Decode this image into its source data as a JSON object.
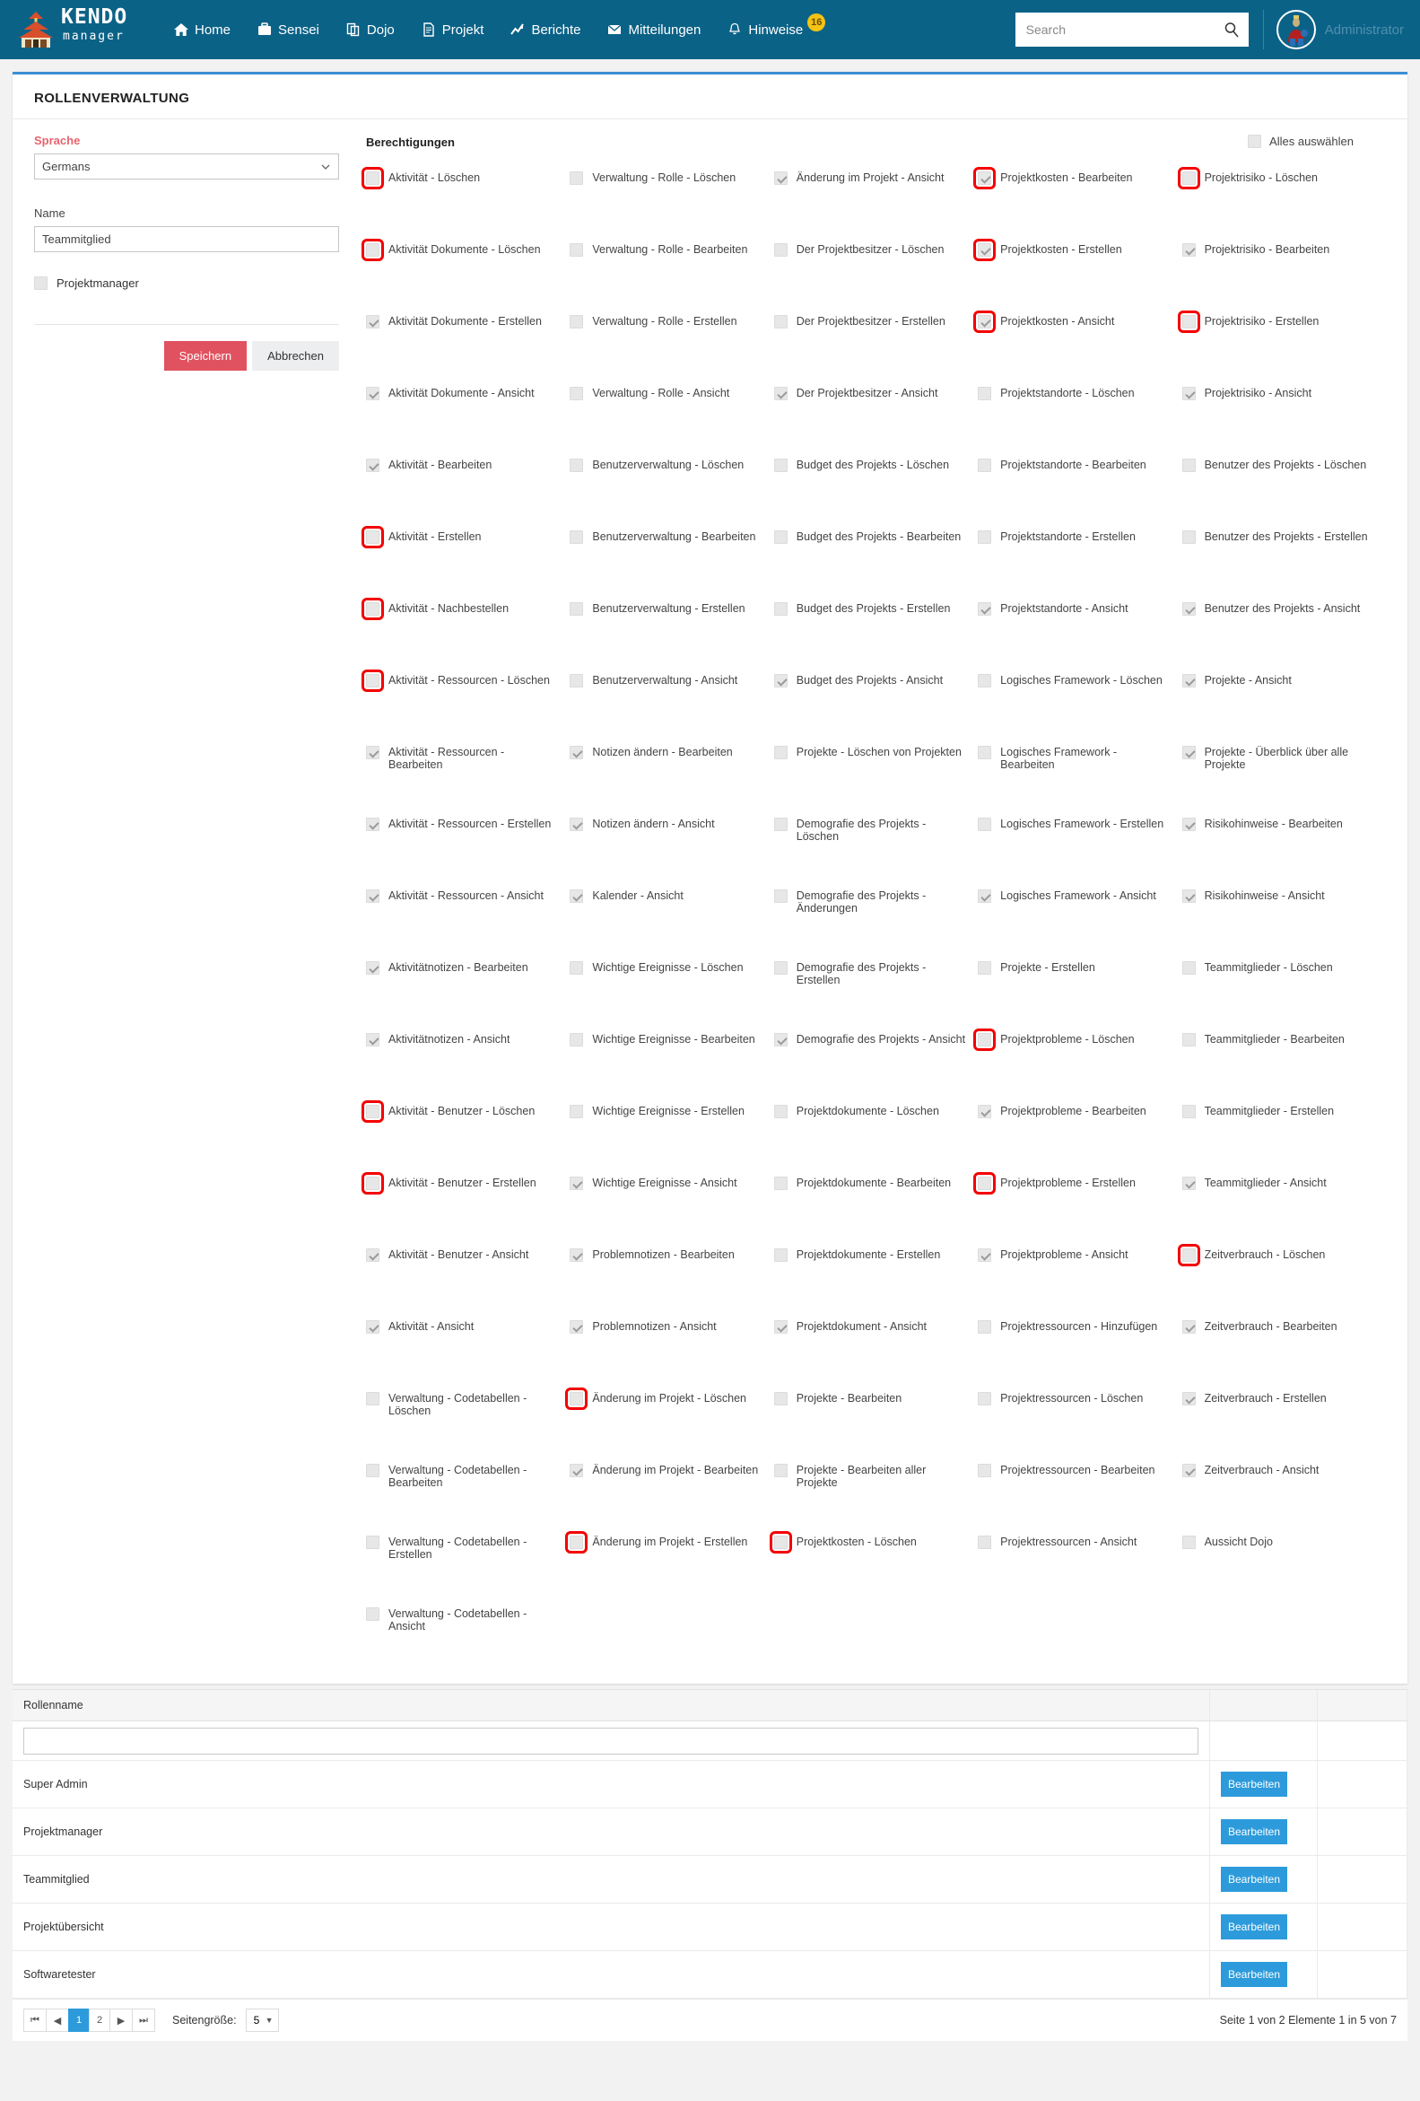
{
  "topbar": {
    "brand_main": "KENDO",
    "brand_sub": "manager",
    "nav": [
      {
        "label": "Home",
        "icon": "home-icon"
      },
      {
        "label": "Sensei",
        "icon": "briefcase-icon"
      },
      {
        "label": "Dojo",
        "icon": "copy-icon"
      },
      {
        "label": "Projekt",
        "icon": "file-icon"
      },
      {
        "label": "Berichte",
        "icon": "chart-icon"
      },
      {
        "label": "Mitteilungen",
        "icon": "envelope-icon"
      },
      {
        "label": "Hinweise",
        "icon": "bell-icon",
        "badge": "16"
      }
    ],
    "search_placeholder": "Search",
    "search_value": "",
    "user_name": "Administrator"
  },
  "card": {
    "title": "ROLLENVERWALTUNG",
    "form": {
      "language_label": "Sprache",
      "language_value": "Germans",
      "name_label": "Name",
      "name_value": "Teammitglied",
      "projectmanager_label": "Projektmanager",
      "projectmanager_checked": false,
      "save_label": "Speichern",
      "cancel_label": "Abbrechen"
    },
    "permissions": {
      "title": "Berechtigungen",
      "select_all_label": "Alles auswählen",
      "select_all_checked": false,
      "columns": [
        [
          {
            "label": "Aktivität - Löschen",
            "checked": false,
            "highlight": true
          },
          {
            "label": "Aktivität Dokumente - Löschen",
            "checked": false,
            "highlight": true
          },
          {
            "label": "Aktivität Dokumente - Erstellen",
            "checked": true,
            "highlight": false
          },
          {
            "label": "Aktivität Dokumente - Ansicht",
            "checked": true,
            "highlight": false
          },
          {
            "label": "Aktivität - Bearbeiten",
            "checked": true,
            "highlight": false
          },
          {
            "label": "Aktivität - Erstellen",
            "checked": false,
            "highlight": true
          },
          {
            "label": "Aktivität - Nachbestellen",
            "checked": false,
            "highlight": true
          },
          {
            "label": "Aktivität - Ressourcen - Löschen",
            "checked": false,
            "highlight": true
          },
          {
            "label": "Aktivität - Ressourcen - Bearbeiten",
            "checked": true,
            "highlight": false
          },
          {
            "label": "Aktivität - Ressourcen - Erstellen",
            "checked": true,
            "highlight": false
          },
          {
            "label": "Aktivität - Ressourcen - Ansicht",
            "checked": true,
            "highlight": false
          },
          {
            "label": "Aktivitätnotizen - Bearbeiten",
            "checked": true,
            "highlight": false
          },
          {
            "label": "Aktivitätnotizen - Ansicht",
            "checked": true,
            "highlight": false
          },
          {
            "label": "Aktivität - Benutzer - Löschen",
            "checked": false,
            "highlight": true
          },
          {
            "label": "Aktivität - Benutzer - Erstellen",
            "checked": false,
            "highlight": true
          },
          {
            "label": "Aktivität - Benutzer - Ansicht",
            "checked": true,
            "highlight": false
          },
          {
            "label": "Aktivität - Ansicht",
            "checked": true,
            "highlight": false
          },
          {
            "label": "Verwaltung - Codetabellen - Löschen",
            "checked": false,
            "highlight": false
          },
          {
            "label": "Verwaltung - Codetabellen - Bearbeiten",
            "checked": false,
            "highlight": false
          },
          {
            "label": "Verwaltung - Codetabellen - Erstellen",
            "checked": false,
            "highlight": false
          },
          {
            "label": "Verwaltung - Codetabellen - Ansicht",
            "checked": false,
            "highlight": false
          }
        ],
        [
          {
            "label": "Verwaltung - Rolle - Löschen",
            "checked": false,
            "highlight": false
          },
          {
            "label": "Verwaltung - Rolle - Bearbeiten",
            "checked": false,
            "highlight": false
          },
          {
            "label": "Verwaltung - Rolle - Erstellen",
            "checked": false,
            "highlight": false
          },
          {
            "label": "Verwaltung - Rolle - Ansicht",
            "checked": false,
            "highlight": false
          },
          {
            "label": "Benutzerverwaltung - Löschen",
            "checked": false,
            "highlight": false
          },
          {
            "label": "Benutzerverwaltung - Bearbeiten",
            "checked": false,
            "highlight": false
          },
          {
            "label": "Benutzerverwaltung - Erstellen",
            "checked": false,
            "highlight": false
          },
          {
            "label": "Benutzerverwaltung - Ansicht",
            "checked": false,
            "highlight": false
          },
          {
            "label": "Notizen ändern - Bearbeiten",
            "checked": true,
            "highlight": false
          },
          {
            "label": "Notizen ändern - Ansicht",
            "checked": true,
            "highlight": false
          },
          {
            "label": "Kalender - Ansicht",
            "checked": true,
            "highlight": false
          },
          {
            "label": "Wichtige Ereignisse - Löschen",
            "checked": false,
            "highlight": false
          },
          {
            "label": "Wichtige Ereignisse - Bearbeiten",
            "checked": false,
            "highlight": false
          },
          {
            "label": "Wichtige Ereignisse - Erstellen",
            "checked": false,
            "highlight": false
          },
          {
            "label": "Wichtige Ereignisse - Ansicht",
            "checked": true,
            "highlight": false
          },
          {
            "label": "Problemnotizen - Bearbeiten",
            "checked": true,
            "highlight": false
          },
          {
            "label": "Problemnotizen - Ansicht",
            "checked": true,
            "highlight": false
          },
          {
            "label": "Änderung im Projekt - Löschen",
            "checked": false,
            "highlight": true
          },
          {
            "label": "Änderung im Projekt - Bearbeiten",
            "checked": true,
            "highlight": false
          },
          {
            "label": "Änderung im Projekt - Erstellen",
            "checked": false,
            "highlight": true
          }
        ],
        [
          {
            "label": "Änderung im Projekt - Ansicht",
            "checked": true,
            "highlight": false
          },
          {
            "label": "Der Projektbesitzer - Löschen",
            "checked": false,
            "highlight": false
          },
          {
            "label": "Der Projektbesitzer - Erstellen",
            "checked": false,
            "highlight": false
          },
          {
            "label": "Der Projektbesitzer - Ansicht",
            "checked": true,
            "highlight": false
          },
          {
            "label": "Budget des Projekts - Löschen",
            "checked": false,
            "highlight": false
          },
          {
            "label": "Budget des Projekts - Bearbeiten",
            "checked": false,
            "highlight": false
          },
          {
            "label": "Budget des Projekts - Erstellen",
            "checked": false,
            "highlight": false
          },
          {
            "label": "Budget des Projekts - Ansicht",
            "checked": true,
            "highlight": false
          },
          {
            "label": "Projekte - Löschen von Projekten",
            "checked": false,
            "highlight": false
          },
          {
            "label": "Demografie des Projekts - Löschen",
            "checked": false,
            "highlight": false
          },
          {
            "label": "Demografie des Projekts - Änderungen",
            "checked": false,
            "highlight": false
          },
          {
            "label": "Demografie des Projekts - Erstellen",
            "checked": false,
            "highlight": false
          },
          {
            "label": "Demografie des Projekts - Ansicht",
            "checked": true,
            "highlight": false
          },
          {
            "label": "Projektdokumente - Löschen",
            "checked": false,
            "highlight": false
          },
          {
            "label": "Projektdokumente - Bearbeiten",
            "checked": false,
            "highlight": false
          },
          {
            "label": "Projektdokumente - Erstellen",
            "checked": false,
            "highlight": false
          },
          {
            "label": "Projektdokument - Ansicht",
            "checked": true,
            "highlight": false
          },
          {
            "label": "Projekte - Bearbeiten",
            "checked": false,
            "highlight": false
          },
          {
            "label": "Projekte - Bearbeiten aller Projekte",
            "checked": false,
            "highlight": false
          },
          {
            "label": "Projektkosten - Löschen",
            "checked": false,
            "highlight": true
          }
        ],
        [
          {
            "label": "Projektkosten - Bearbeiten",
            "checked": true,
            "highlight": true
          },
          {
            "label": "Projektkosten - Erstellen",
            "checked": true,
            "highlight": true
          },
          {
            "label": "Projektkosten - Ansicht",
            "checked": true,
            "highlight": true
          },
          {
            "label": "Projektstandorte - Löschen",
            "checked": false,
            "highlight": false
          },
          {
            "label": "Projektstandorte - Bearbeiten",
            "checked": false,
            "highlight": false
          },
          {
            "label": "Projektstandorte - Erstellen",
            "checked": false,
            "highlight": false
          },
          {
            "label": "Projektstandorte - Ansicht",
            "checked": true,
            "highlight": false
          },
          {
            "label": "Logisches Framework - Löschen",
            "checked": false,
            "highlight": false
          },
          {
            "label": "Logisches Framework - Bearbeiten",
            "checked": false,
            "highlight": false
          },
          {
            "label": "Logisches Framework - Erstellen",
            "checked": false,
            "highlight": false
          },
          {
            "label": "Logisches Framework - Ansicht",
            "checked": true,
            "highlight": false
          },
          {
            "label": "Projekte - Erstellen",
            "checked": false,
            "highlight": false
          },
          {
            "label": "Projektprobleme - Löschen",
            "checked": false,
            "highlight": true
          },
          {
            "label": "Projektprobleme - Bearbeiten",
            "checked": true,
            "highlight": false
          },
          {
            "label": "Projektprobleme - Erstellen",
            "checked": false,
            "highlight": true
          },
          {
            "label": "Projektprobleme - Ansicht",
            "checked": true,
            "highlight": false
          },
          {
            "label": "Projektressourcen - Hinzufügen",
            "checked": false,
            "highlight": false
          },
          {
            "label": "Projektressourcen - Löschen",
            "checked": false,
            "highlight": false
          },
          {
            "label": "Projektressourcen - Bearbeiten",
            "checked": false,
            "highlight": false
          },
          {
            "label": "Projektressourcen - Ansicht",
            "checked": false,
            "highlight": false
          }
        ],
        [
          {
            "label": "Projektrisiko - Löschen",
            "checked": false,
            "highlight": true
          },
          {
            "label": "Projektrisiko - Bearbeiten",
            "checked": true,
            "highlight": false
          },
          {
            "label": "Projektrisiko - Erstellen",
            "checked": false,
            "highlight": true
          },
          {
            "label": "Projektrisiko - Ansicht",
            "checked": true,
            "highlight": false
          },
          {
            "label": "Benutzer des Projekts - Löschen",
            "checked": false,
            "highlight": false
          },
          {
            "label": "Benutzer des Projekts - Erstellen",
            "checked": false,
            "highlight": false
          },
          {
            "label": "Benutzer des Projekts - Ansicht",
            "checked": true,
            "highlight": false
          },
          {
            "label": "Projekte - Ansicht",
            "checked": true,
            "highlight": false
          },
          {
            "label": "Projekte - Überblick über alle Projekte",
            "checked": true,
            "highlight": false
          },
          {
            "label": "Risikohinweise - Bearbeiten",
            "checked": true,
            "highlight": false
          },
          {
            "label": "Risikohinweise - Ansicht",
            "checked": true,
            "highlight": false
          },
          {
            "label": "Teammitglieder - Löschen",
            "checked": false,
            "highlight": false
          },
          {
            "label": "Teammitglieder - Bearbeiten",
            "checked": false,
            "highlight": false
          },
          {
            "label": "Teammitglieder - Erstellen",
            "checked": false,
            "highlight": false
          },
          {
            "label": "Teammitglieder - Ansicht",
            "checked": true,
            "highlight": false
          },
          {
            "label": "Zeitverbrauch - Löschen",
            "checked": false,
            "highlight": true
          },
          {
            "label": "Zeitverbrauch - Bearbeiten",
            "checked": true,
            "highlight": false
          },
          {
            "label": "Zeitverbrauch - Erstellen",
            "checked": true,
            "highlight": false
          },
          {
            "label": "Zeitverbrauch - Ansicht",
            "checked": true,
            "highlight": false
          },
          {
            "label": "Aussicht Dojo",
            "checked": false,
            "highlight": false
          }
        ]
      ]
    }
  },
  "grid": {
    "header_rolename": "Rollenname",
    "filter_value": "",
    "rows": [
      {
        "name": "Super Admin",
        "action": "Bearbeiten"
      },
      {
        "name": "Projektmanager",
        "action": "Bearbeiten"
      },
      {
        "name": "Teammitglied",
        "action": "Bearbeiten"
      },
      {
        "name": "Projektübersicht",
        "action": "Bearbeiten"
      },
      {
        "name": "Softwaretester",
        "action": "Bearbeiten"
      }
    ],
    "pager": {
      "first": "⏮",
      "prev": "◀",
      "pages": [
        "1",
        "2"
      ],
      "active_page": "1",
      "next": "▶",
      "last": "⏭",
      "pagesize_label": "Seitengröße:",
      "pagesize_value": "5",
      "info": "Seite 1 von 2 Elemente 1 in 5 von 7"
    }
  }
}
